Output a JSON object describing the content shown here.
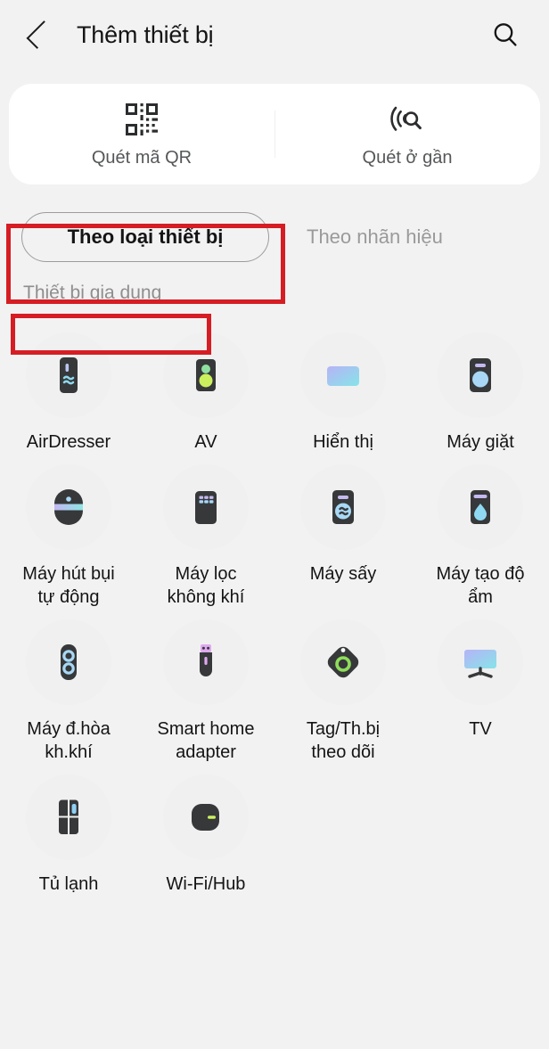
{
  "header": {
    "title": "Thêm thiết bị",
    "back_icon": "chevron-left-icon",
    "search_icon": "search-icon"
  },
  "scan_options": [
    {
      "label": "Quét mã QR",
      "icon": "qr-code-icon"
    },
    {
      "label": "Quét ở gần",
      "icon": "nearby-scan-icon"
    }
  ],
  "tabs": [
    {
      "label": "Theo loại thiết bị",
      "selected": true
    },
    {
      "label": "Theo nhãn hiệu",
      "selected": false
    }
  ],
  "section": {
    "label": "Thiết bị gia dụng"
  },
  "devices": [
    {
      "label": "AirDresser",
      "icon": "airdresser-icon"
    },
    {
      "label": "AV",
      "icon": "av-speaker-icon"
    },
    {
      "label": "Hiển thị",
      "icon": "display-icon"
    },
    {
      "label": "Máy giặt",
      "icon": "washing-machine-icon"
    },
    {
      "label": "Máy hút bụi\ntự động",
      "icon": "robot-vacuum-icon"
    },
    {
      "label": "Máy lọc\nkhông khí",
      "icon": "air-purifier-icon"
    },
    {
      "label": "Máy sấy",
      "icon": "dryer-icon"
    },
    {
      "label": "Máy tạo độ\nẩm",
      "icon": "humidifier-icon"
    },
    {
      "label": "Máy đ.hòa\nkh.khí",
      "icon": "air-conditioner-icon"
    },
    {
      "label": "Smart home\nadapter",
      "icon": "smart-home-adapter-icon"
    },
    {
      "label": "Tag/Th.bị\ntheo dõi",
      "icon": "smart-tag-icon"
    },
    {
      "label": "TV",
      "icon": "tv-icon"
    },
    {
      "label": "Tủ lạnh",
      "icon": "refrigerator-icon"
    },
    {
      "label": "Wi-Fi/Hub",
      "icon": "wifi-hub-icon"
    }
  ],
  "annotations": [
    {
      "name": "highlight-tab-device-type",
      "color": "#d61d24"
    },
    {
      "name": "highlight-section-label",
      "color": "#d61d24"
    }
  ],
  "colors": {
    "page_background": "#f2f2f2",
    "card_background": "#ffffff",
    "bubble_background": "#f0f0f0",
    "icon_dark": "#36383a",
    "accent_red": "#d61d24",
    "muted_text": "#8e8e8e"
  }
}
